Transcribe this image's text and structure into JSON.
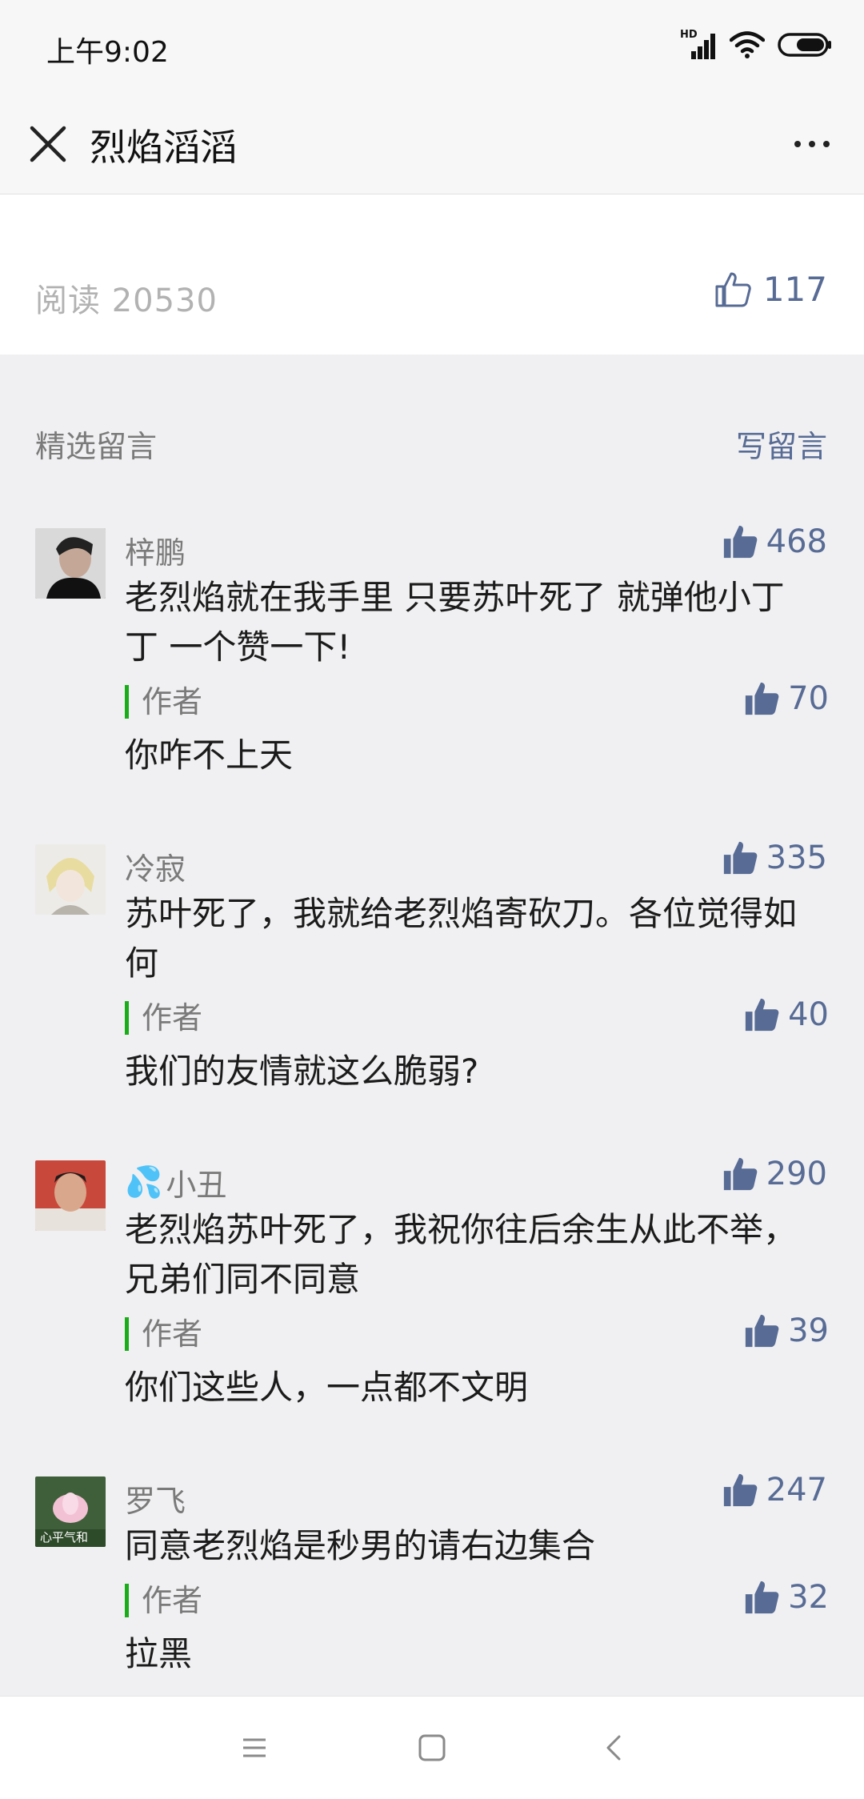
{
  "status_bar": {
    "time": "上午9:02",
    "network": "HD"
  },
  "nav": {
    "title": "烈焰滔滔"
  },
  "article": {
    "read_label": "阅读 20530",
    "like_count": "117"
  },
  "comments_section": {
    "title": "精选留言",
    "write_label": "写留言"
  },
  "comments": [
    {
      "name": "梓鹏",
      "likes": "468",
      "text": "老烈焰就在我手里 只要苏叶死了 就弹他小丁丁  一个赞一下!",
      "reply": {
        "label": "作者",
        "likes": "70",
        "text": "你咋不上天"
      }
    },
    {
      "name": "冷寂",
      "likes": "335",
      "text": "苏叶死了，我就给老烈焰寄砍刀。各位觉得如何",
      "reply": {
        "label": "作者",
        "likes": "40",
        "text": "我们的友情就这么脆弱?"
      }
    },
    {
      "name": "小丑",
      "name_emoji": "💦",
      "likes": "290",
      "text": "老烈焰苏叶死了，我祝你往后余生从此不举，兄弟们同不同意",
      "reply": {
        "label": "作者",
        "likes": "39",
        "text": "你们这些人，一点都不文明"
      }
    },
    {
      "name": "罗飞",
      "likes": "247",
      "text": "同意老烈焰是秒男的请右边集合",
      "avatar_caption": "心平气和",
      "reply": {
        "label": "作者",
        "likes": "32",
        "text": "拉黑"
      }
    }
  ],
  "colors": {
    "link": "#576b95",
    "author_bar": "#1aad19",
    "muted": "#7a7a7a"
  }
}
